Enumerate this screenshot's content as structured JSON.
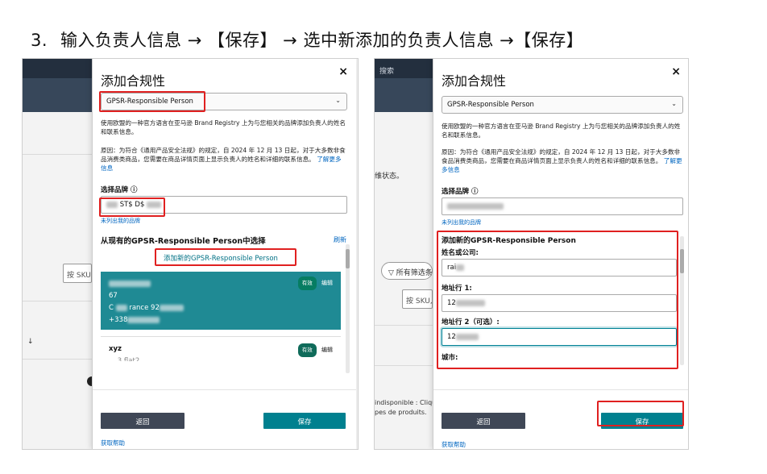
{
  "heading": {
    "number": "3.",
    "text": "输入负责人信息 → 【保存】 → 选中新添加的负责人信息 →【保存】"
  },
  "left": {
    "bg": {
      "sku_placeholder": "按 SKU,",
      "arrow": "↓"
    },
    "modal": {
      "title": "添加合规性",
      "close": "×",
      "select_value": "GPSR-Responsible Person",
      "intro": "使用欧盟的一种官方语言在亚马逊 Brand Registry 上为与您相关的品牌添加负责人的姓名和联系信息。",
      "reason": "原因：为符合《通用产品安全法规》的规定，自 2024 年 12 月 13 日起，对于大多数非食品消费类商品，您需要在商品详情页面上显示负责人的姓名和详细的联系信息。",
      "learn_more": "了解更多信息",
      "brand_label": "选择品牌 ⓘ",
      "brand_value": "ST$ D$",
      "brand_hint": "未列出我的品牌",
      "choose_existing": "从现有的GPSR-Responsible Person中选择",
      "refresh": "刷新",
      "add_new_link": "添加新的GPSR-Responsible Person",
      "card1": {
        "line1": "67",
        "line2_prefix": "C",
        "line2_mid": "rance 92",
        "line3": "+338",
        "status": "有效",
        "edit": "编辑"
      },
      "card2": {
        "name": "xyz",
        "line2": "... 3 flat2",
        "status": "有效",
        "edit": "编辑"
      },
      "back": "返回",
      "save": "保存",
      "help": "获取帮助"
    }
  },
  "right": {
    "bg": {
      "search": "搜索",
      "status_text": "维状态。",
      "filter": "所有筛选条",
      "sku": "按 SKU,",
      "bottom1": "indisponible : Cliqu",
      "bottom2": "pes de produits."
    },
    "modal": {
      "title": "添加合规性",
      "close": "×",
      "select_value": "GPSR-Responsible Person",
      "intro": "使用欧盟的一种官方语言在亚马逊 Brand Registry 上为与您相关的品牌添加负责人的姓名和联系信息。",
      "reason": "原因：为符合《通用产品安全法规》的规定，自 2024 年 12 月 13 日起，对于大多数非食品消费类商品，您需要在商品详情页面上显示负责人的姓名和详细的联系信息。",
      "learn_more": "了解更多信息",
      "brand_label": "选择品牌 ⓘ",
      "brand_hint": "未列出我的品牌",
      "section_title": "添加新的GPSR-Responsible Person",
      "name_label": "姓名或公司:",
      "name_value": "rai",
      "addr1_label": "地址行 1:",
      "addr1_value": "12",
      "addr2_label": "地址行 2（可选）:",
      "addr2_value": "12",
      "city_label": "城市:",
      "back": "返回",
      "save": "保存",
      "help": "获取帮助"
    }
  },
  "colors": {
    "highlight": "#e02020",
    "teal": "#00808f",
    "link": "#0066c0"
  }
}
